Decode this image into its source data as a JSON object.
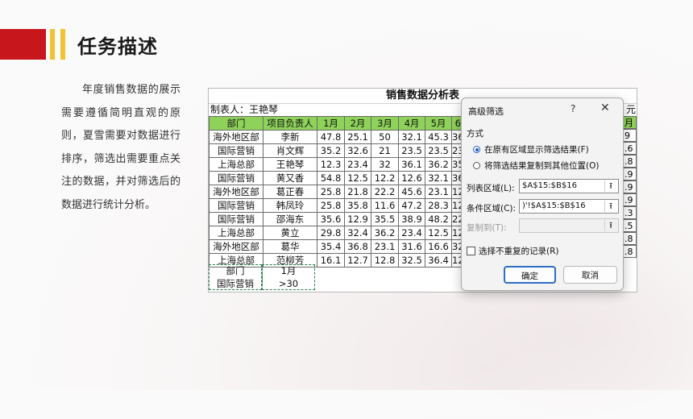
{
  "slide": {
    "title": "任务描述",
    "description": "年度销售数据的展示需要遵循简明直观的原则，夏雪需要对数据进行排序，筛选出需要重点关注的数据，并对筛选后的数据进行统计分析。"
  },
  "sheet": {
    "title": "销售数据分析表",
    "maker": "制表人：王艳琴",
    "unit_fragment": "元",
    "headers": [
      "部门",
      "项目负责人",
      "1月",
      "2月",
      "3月",
      "4月",
      "5月",
      "6"
    ],
    "rows": [
      [
        "海外地区部",
        "李新",
        "47.8",
        "25.1",
        "50",
        "32.1",
        "45.3",
        "36"
      ],
      [
        "国际营销",
        "肖文辉",
        "35.2",
        "32.6",
        "21",
        "23.5",
        "23.5",
        "23"
      ],
      [
        "上海总部",
        "王艳琴",
        "12.3",
        "23.4",
        "32",
        "36.1",
        "36.2",
        "35"
      ],
      [
        "国际营销",
        "黄又香",
        "54.8",
        "12.5",
        "12.2",
        "12.6",
        "32.1",
        "36"
      ],
      [
        "海外地区部",
        "葛正春",
        "25.8",
        "21.8",
        "22.2",
        "45.6",
        "23.1",
        "12"
      ],
      [
        "国际营销",
        "韩凤玲",
        "25.8",
        "35.8",
        "11.6",
        "47.2",
        "28.3",
        "12"
      ],
      [
        "国际营销",
        "邵海东",
        "35.6",
        "12.9",
        "35.5",
        "38.9",
        "48.2",
        "22"
      ],
      [
        "上海总部",
        "黄立",
        "29.8",
        "32.4",
        "36.2",
        "23.4",
        "12.5",
        "12"
      ],
      [
        "海外地区部",
        "葛华",
        "35.4",
        "36.8",
        "23.1",
        "31.6",
        "16.6",
        "32"
      ],
      [
        "上海总部",
        "范柳芳",
        "16.1",
        "12.7",
        "12.8",
        "32.5",
        "36.4",
        "12"
      ]
    ],
    "right_header": "月",
    "right_values": [
      "9",
      ".6",
      ".8",
      ".9",
      ".9",
      ".9",
      ".3",
      ".5",
      ".8",
      ".8"
    ],
    "criteria": {
      "headers": [
        "部门",
        "1月"
      ],
      "values": [
        "国际营销",
        ">30"
      ]
    }
  },
  "dialog": {
    "title": "高级筛选",
    "help": "?",
    "close": "✕",
    "mode_label": "方式",
    "radio_in_place": "在原有区域显示筛选结果(F)",
    "radio_copy": "将筛选结果复制到其他位置(O)",
    "list_range_label": "列表区域(L):",
    "list_range_value": "$A$15:$B$16",
    "criteria_range_label": "条件区域(C):",
    "criteria_range_value": ")'!$A$15:$B$16",
    "copy_to_label": "复制到(T):",
    "unique_label": "选择不重复的记录(R)",
    "ok_label": "确定",
    "cancel_label": "取消"
  }
}
